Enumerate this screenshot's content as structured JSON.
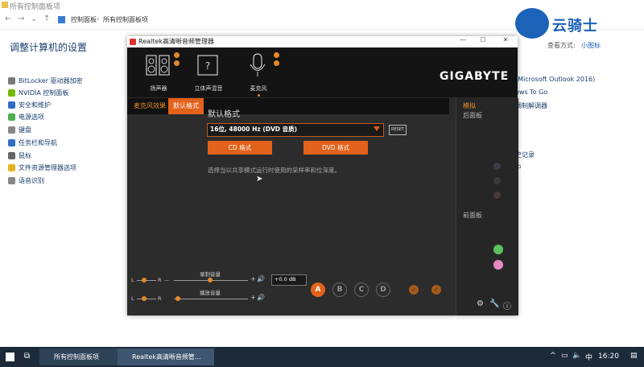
{
  "control_panel": {
    "window_title": "所有控制面板项",
    "breadcrumb": [
      "控制面板",
      "所有控制面板项"
    ],
    "heading": "调整计算机的设置",
    "view_by_label": "查看方式:",
    "view_by_value": "小图标",
    "left_items": [
      {
        "label": "BitLocker 驱动器加密",
        "color": "#7a7a7a"
      },
      {
        "label": "NVIDIA 控制面板",
        "color": "#76b900"
      },
      {
        "label": "安全和维护",
        "color": "#2f6cc4"
      },
      {
        "label": "电源选项",
        "color": "#4caf50"
      },
      {
        "label": "键盘",
        "color": "#888888"
      },
      {
        "label": "任务栏和导航",
        "color": "#2f6cc4"
      },
      {
        "label": "鼠标",
        "color": "#666666"
      },
      {
        "label": "文件资源管理器选项",
        "color": "#e6b422"
      },
      {
        "label": "语音识别",
        "color": "#888888"
      }
    ],
    "right_items": [
      "(Microsoft Outlook 2016)",
      "ows To Go",
      "调制解调器",
      "史记录",
      "户"
    ]
  },
  "watermark": {
    "text": "云骑士"
  },
  "realtek": {
    "window_title": "Realtek高清晰音频管理器",
    "brand": "GIGABYTE",
    "device_tabs": [
      {
        "label": "扬声器",
        "icon": "speaker-icon"
      },
      {
        "label": "立体声混音",
        "icon": "chip-icon"
      },
      {
        "label": "麦克风",
        "icon": "microphone-icon"
      }
    ],
    "sub_tabs": [
      "麦克风效果",
      "默认格式"
    ],
    "section_title": "默认格式",
    "format_value": "16位, 48000 Hz (DVD 音质)",
    "reset_label": "RESET",
    "cd_button": "CD 格式",
    "dvd_button": "DVD 格式",
    "description": "选择当以共享模式运行时使用的采样率和位深度。",
    "side": {
      "analog": "模拟",
      "rear": "后面板",
      "front": "前面板"
    },
    "record_volume_label": "录制音量",
    "playback_volume_label": "播放音量",
    "lr_left": "L",
    "lr_right": "R",
    "db_value": "+0.0 dB",
    "profile_buttons": [
      "A",
      "B",
      "C",
      "D"
    ],
    "accent": "#e2621b"
  },
  "taskbar": {
    "items": [
      "所有控制面板项",
      "Realtek高清晰音频管..."
    ],
    "ime": "中",
    "time": "16:20"
  }
}
